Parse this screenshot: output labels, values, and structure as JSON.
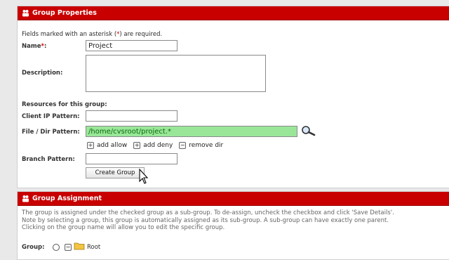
{
  "group_properties": {
    "title": "Group Properties",
    "required_note_prefix": "Fields marked with an asterisk (",
    "required_note_star": "*",
    "required_note_suffix": ") are required.",
    "name_label": "Name",
    "name_star": "*",
    "name_colon": ":",
    "name_value": "Project",
    "description_label": "Description:",
    "description_value": "",
    "resources_heading": "Resources for this group:",
    "client_ip_label": "Client IP Pattern:",
    "client_ip_value": "",
    "file_dir_label": "File / Dir Pattern:",
    "file_dir_value": "/home/cvsroot/project.*",
    "add_allow": "add allow",
    "add_deny": "add deny",
    "remove_dir": "remove dir",
    "branch_label": "Branch Pattern:",
    "branch_value": "",
    "create_button": "Create Group"
  },
  "group_assignment": {
    "title": "Group Assignment",
    "line1": "The group is assigned under the checked group as a sub-group. To de-assign, uncheck the checkbox and click 'Save Details'.",
    "line2": "Note by selecting a group, this group is automatically assigned as its sub-group. A sub-group can have exactly one parent.",
    "line3": "Clicking on the group name will allow you to edit the specific group.",
    "group_label": "Group:",
    "tree_node": "Root"
  },
  "colors": {
    "header_red": "#c80000",
    "highlight_green": "#99e699",
    "required_red": "#d00000"
  },
  "icons": [
    "group-icon",
    "search-icon",
    "plus-icon",
    "minus-icon",
    "folder-icon",
    "cursor-icon"
  ]
}
